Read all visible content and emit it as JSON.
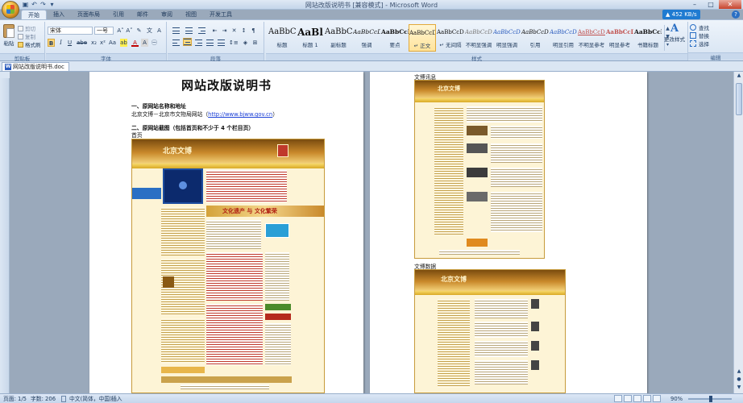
{
  "window": {
    "title": "网站改版说明书 [兼容模式] - Microsoft Word",
    "controls": [
      "–",
      "□",
      "✕"
    ]
  },
  "ribbon": {
    "tabs": [
      "开始",
      "插入",
      "页面布局",
      "引用",
      "邮件",
      "审阅",
      "视图",
      "开发工具"
    ],
    "active_tab": "开始",
    "speed": "452 KB/s",
    "clipboard": {
      "paste": "粘贴",
      "cut": "剪切",
      "copy": "复制",
      "format_painter": "格式刷",
      "label": "剪贴板"
    },
    "font": {
      "name": "宋体",
      "size": "一号",
      "label": "字体"
    },
    "paragraph": {
      "label": "段落"
    },
    "styles": {
      "label": "样式",
      "items": [
        {
          "preview": "AaBbC",
          "name": "标题"
        },
        {
          "preview": "AaBl",
          "name": "标题 1"
        },
        {
          "preview": "AaBbC",
          "name": "副标题"
        },
        {
          "preview": "AaBbCcD",
          "name": "强调"
        },
        {
          "preview": "AaBbCcD",
          "name": "要点"
        },
        {
          "preview": "AaBbCcDd",
          "name": "↵ 正文"
        },
        {
          "preview": "AaBbCcDd",
          "name": "↵ 无间隔"
        },
        {
          "preview": "AaBbCcDd",
          "name": "不明显强调"
        },
        {
          "preview": "AaBbCcDd",
          "name": "明显强调"
        },
        {
          "preview": "AaBbCcDd",
          "name": "引用"
        },
        {
          "preview": "AaBbCcDd",
          "name": "明显引用"
        },
        {
          "preview": "AaBbCcDd",
          "name": "不明显参考"
        },
        {
          "preview": "AaBbCcD",
          "name": "明显参考"
        },
        {
          "preview": "AaBbCcI",
          "name": "书籍标题"
        }
      ],
      "selected_index": 5,
      "change_styles": "更改样式"
    },
    "editing": {
      "find": "查找",
      "replace": "替换",
      "select": "选择",
      "label": "编辑"
    }
  },
  "document_tab": "网站改版说明书.doc",
  "document": {
    "title": "网站改版说明书",
    "section1_heading": "一、原网站名称和地址",
    "section1_text": "北京文博－北京市文物局网站（",
    "section1_link": "http://www.bjww.gov.cn",
    "section1_tail": "）",
    "section2_heading": "二、原网站截图（包括首页和不少于 4 个栏目页）",
    "homepage_label": "首页",
    "page2_label_1": "文博讯息",
    "page2_label_2": "文博数据",
    "shot_logo": "北京文博",
    "banner_slogan": "文化遗产 与 文化繁荣"
  },
  "statusbar": {
    "page": "页面: 1/5",
    "words": "字数: 206",
    "language": "中文(简体，中国)",
    "mode": "插入",
    "zoom": "90%"
  },
  "colors": {
    "accent": "#1f7bd1",
    "site_gold": "#d9a926",
    "site_brown": "#7a4c0f"
  }
}
